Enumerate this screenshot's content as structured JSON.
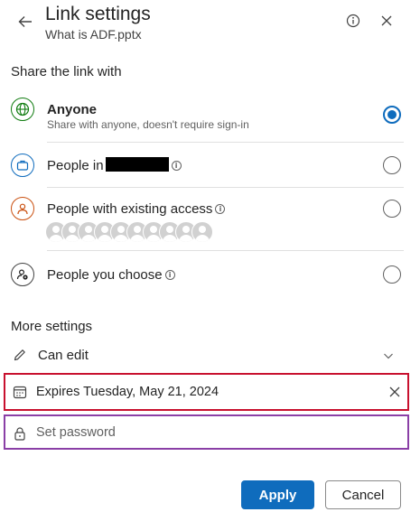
{
  "header": {
    "title": "Link settings",
    "subtitle": "What is ADF.pptx",
    "back_icon": "arrow-left-icon",
    "info_icon": "info-icon",
    "close_icon": "close-icon"
  },
  "share_section": {
    "label": "Share the link with",
    "options": [
      {
        "id": "anyone",
        "title": "Anyone",
        "subtitle": "Share with anyone, doesn't require sign-in",
        "icon": "globe-icon",
        "icon_color": "#107c10",
        "selected": true
      },
      {
        "id": "org",
        "title": "People in",
        "icon": "briefcase-icon",
        "icon_color": "#0f6cbd",
        "selected": false
      },
      {
        "id": "existing",
        "title": "People with existing access",
        "icon": "person-icon",
        "icon_color": "#ca5010",
        "selected": false
      },
      {
        "id": "choose",
        "title": "People you choose",
        "icon": "people-settings-icon",
        "icon_color": "#242424",
        "selected": false
      }
    ]
  },
  "more_settings": {
    "label": "More settings",
    "permission": {
      "label": "Can edit",
      "icon": "pencil-icon"
    },
    "expiration": {
      "value": "Expires Tuesday, May 21, 2024",
      "icon": "calendar-icon"
    },
    "password": {
      "placeholder": "Set password",
      "icon": "lock-icon"
    }
  },
  "footer": {
    "apply_label": "Apply",
    "cancel_label": "Cancel"
  },
  "colors": {
    "accent": "#0f6cbd",
    "expiration_highlight": "#c8102e",
    "password_highlight": "#8a3fa6"
  }
}
